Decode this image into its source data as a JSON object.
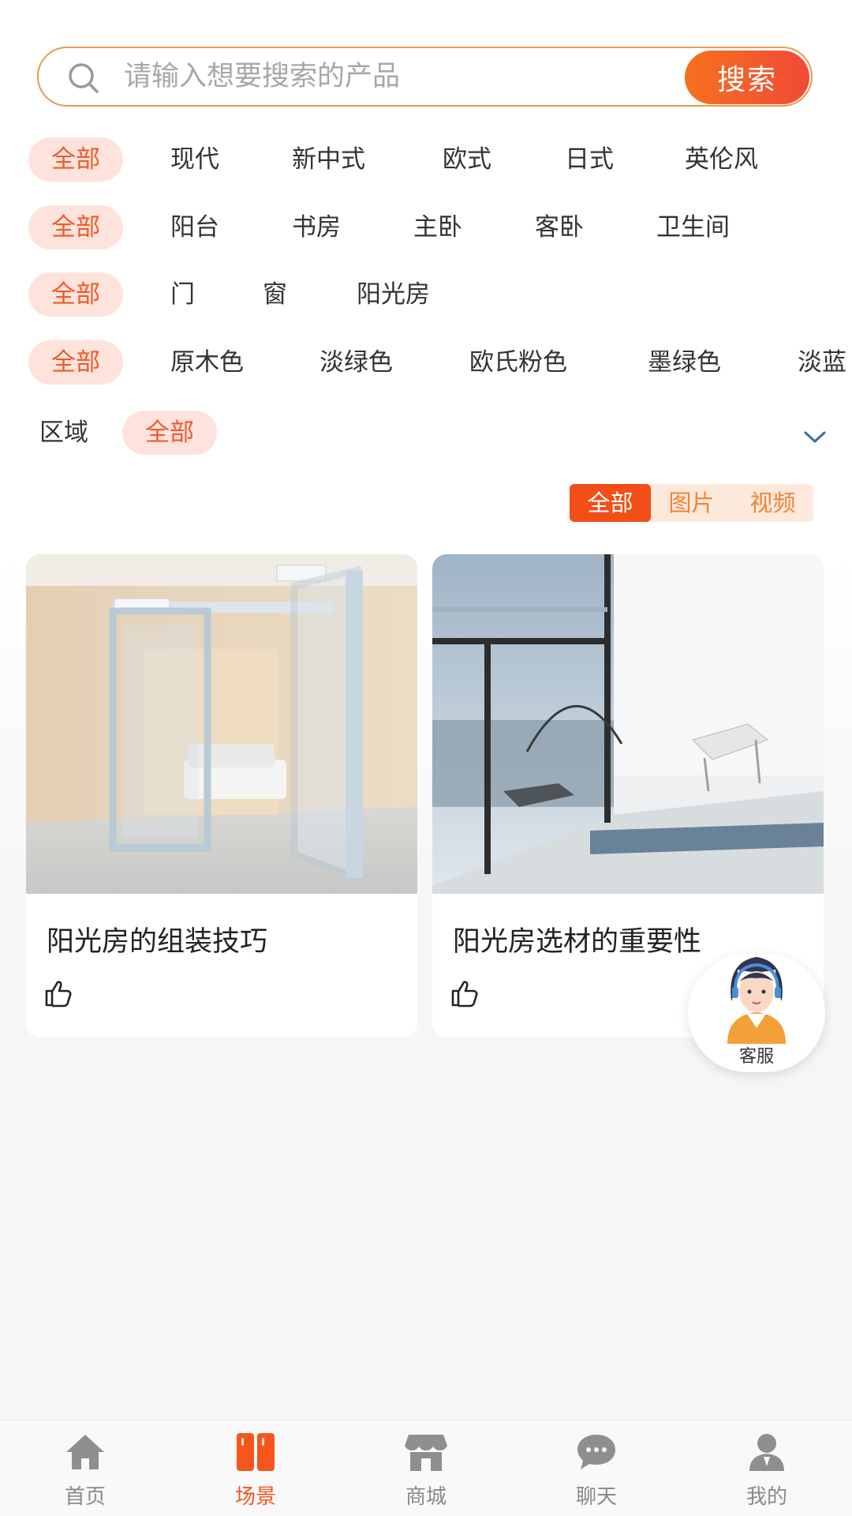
{
  "search": {
    "placeholder": "请输入想要搜索的产品",
    "button_label": "搜索"
  },
  "filters": {
    "style": [
      "全部",
      "现代",
      "新中式",
      "欧式",
      "日式",
      "英伦风"
    ],
    "room": [
      "全部",
      "阳台",
      "书房",
      "主卧",
      "客卧",
      "卫生间"
    ],
    "type": [
      "全部",
      "门",
      "窗",
      "阳光房"
    ],
    "color": [
      "全部",
      "原木色",
      "淡绿色",
      "欧氏粉色",
      "墨绿色",
      "淡蓝"
    ],
    "region": {
      "label": "区域",
      "selected": "全部"
    }
  },
  "media_filter": {
    "options": [
      "全部",
      "图片",
      "视频"
    ],
    "selected": "全部"
  },
  "cards": [
    {
      "title": "阳光房的组装技巧",
      "image": "automatic-glass-door-photo",
      "icon": "thumbs-up-icon"
    },
    {
      "title": "阳光房选材的重要性",
      "image": "sunroom-glass-balcony-photo",
      "icon": "thumbs-up-icon"
    }
  ],
  "customer_service": {
    "label": "客服",
    "icon": "agent-avatar-icon"
  },
  "tabbar": [
    {
      "label": "首页",
      "icon": "home-icon"
    },
    {
      "label": "场景",
      "icon": "scene-icon",
      "active": true
    },
    {
      "label": "商城",
      "icon": "store-icon"
    },
    {
      "label": "聊天",
      "icon": "chat-icon"
    },
    {
      "label": "我的",
      "icon": "profile-icon"
    }
  ],
  "colors": {
    "accent": "#f2551f",
    "chip_bg": "#fde3dc",
    "inactive": "#8a8a8a"
  }
}
